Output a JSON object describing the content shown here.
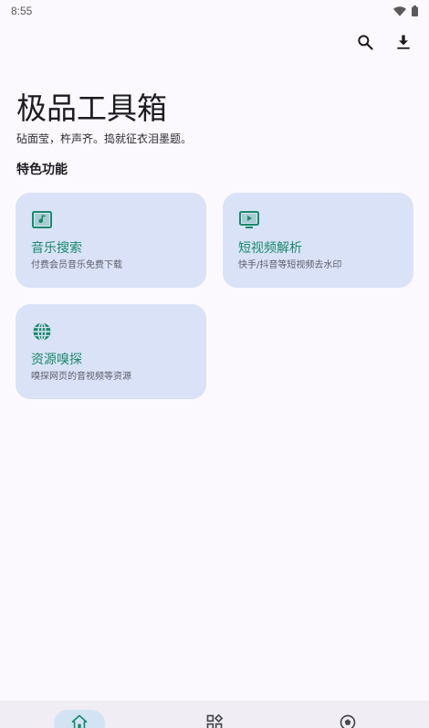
{
  "status_bar": {
    "time": "8:55",
    "icons": [
      "wifi-icon",
      "battery-icon"
    ]
  },
  "top_actions": {
    "icons": [
      "search-icon",
      "download-icon"
    ]
  },
  "header": {
    "title": "极品工具箱",
    "subtitle": "砧面莹，杵声齐。捣就征衣泪墨题。"
  },
  "section": {
    "title": "特色功能"
  },
  "cards": [
    {
      "title": "音乐搜索",
      "desc": "付费会员音乐免费下载",
      "icon": "music-note-icon"
    },
    {
      "title": "短视频解析",
      "desc": "快手/抖音等短视频去水印",
      "icon": "video-play-icon"
    },
    {
      "title": "资源嗅探",
      "desc": "嗅探网页的音视频等资源",
      "icon": "globe-icon"
    }
  ],
  "bottom_nav": {
    "items": [
      {
        "icon": "home-icon",
        "active": true
      },
      {
        "icon": "apps-icon",
        "active": false
      },
      {
        "icon": "football-icon",
        "active": false
      }
    ]
  },
  "colors": {
    "accent": "#1a8a6b",
    "card_background": "#d9e2f7",
    "page_background": "#fcf9fe",
    "nav_background": "#f1edf4",
    "nav_active_pill": "#d2e4f3"
  }
}
